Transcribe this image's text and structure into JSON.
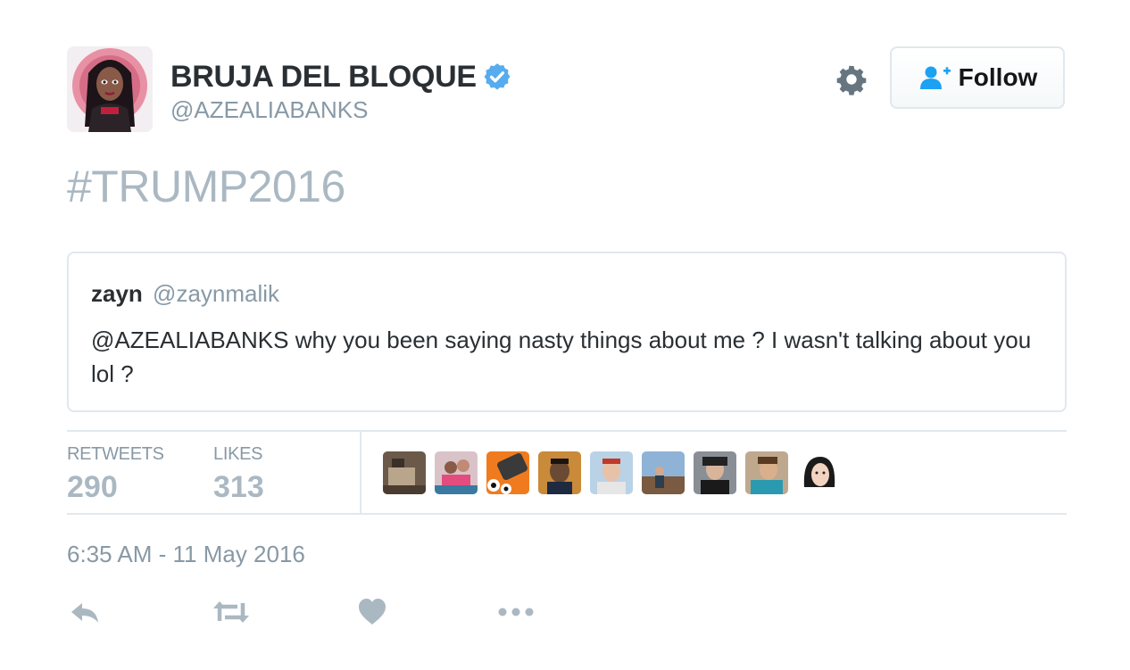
{
  "user": {
    "display_name": "BRUJA DEL BLOQUE",
    "handle": "@AZEALIABANKS",
    "verified": true
  },
  "header": {
    "follow_label": "Follow",
    "settings_icon": "gear-icon",
    "follow_icon": "add-user-icon"
  },
  "tweet": {
    "text": "#TRUMP2016",
    "timestamp": "6:35 AM - 11 May 2016"
  },
  "quoted_tweet": {
    "name": "zayn",
    "handle": "@zaynmalik",
    "text": "@AZEALIABANKS why you been saying nasty things about me ? I wasn't talking about you lol ?"
  },
  "stats": {
    "retweets_label": "RETWEETS",
    "retweets_value": "290",
    "likes_label": "LIKES",
    "likes_value": "313"
  },
  "likers_count_shown": 9,
  "actions": [
    "reply-icon",
    "retweet-icon",
    "heart-icon",
    "more-icon"
  ],
  "colors": {
    "text_primary": "#292f33",
    "text_secondary": "#8899a6",
    "muted": "#aab8c2",
    "border": "#e1e8ed",
    "verified_blue": "#55acee",
    "follow_icon_blue": "#1da1f2"
  }
}
